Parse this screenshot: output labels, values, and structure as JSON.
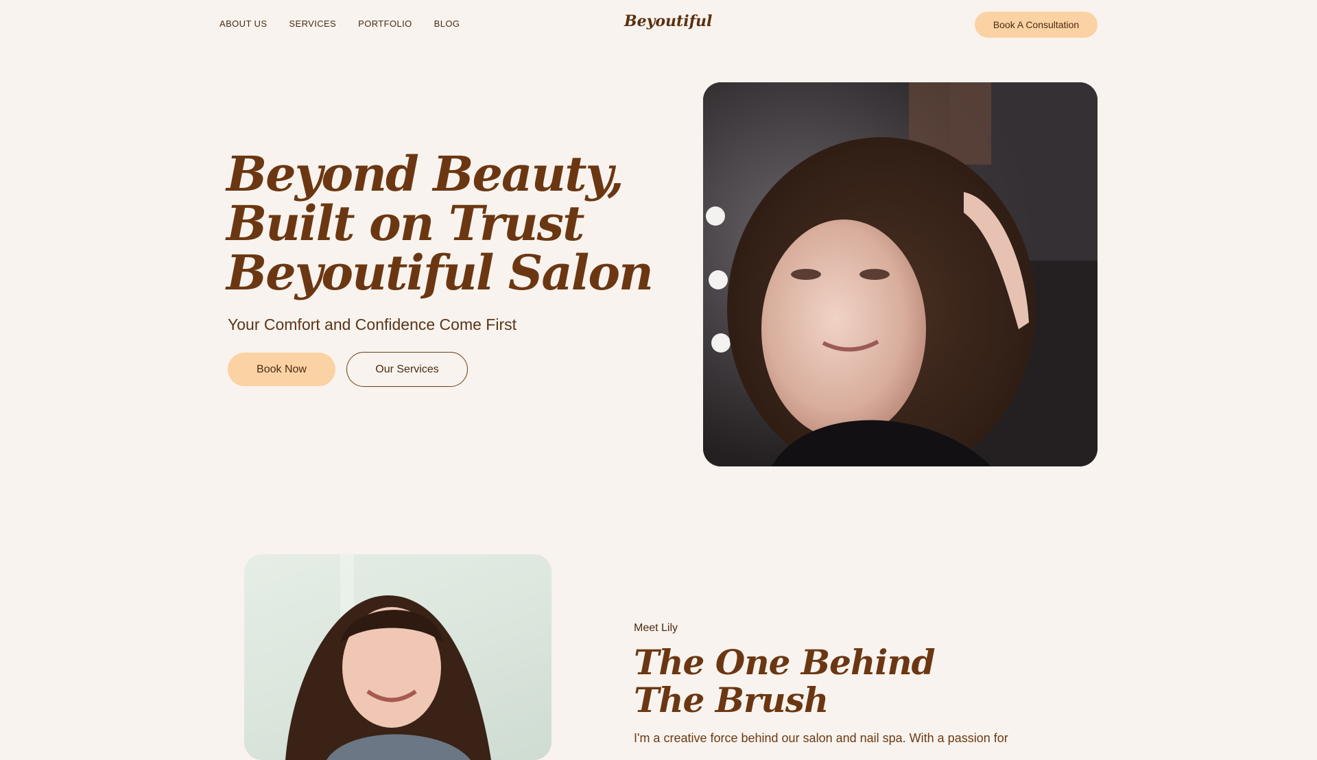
{
  "nav": {
    "links": [
      "ABOUT US",
      "SERVICES",
      "PORTFOLIO",
      "BLOG"
    ],
    "brand": "Beyoutiful",
    "cta_label": "Book A Consultation"
  },
  "hero": {
    "title_lines": [
      "Beyond Beauty,",
      "Built on Trust",
      "Beyoutiful Salon"
    ],
    "subtitle": "Your Comfort and Confidence Come First",
    "primary_button": "Book Now",
    "secondary_button": "Our Services"
  },
  "about": {
    "eyebrow": "Meet Lily",
    "title_lines": [
      "The One Behind",
      "The Brush"
    ],
    "body": "I'm a creative force behind our salon and nail spa. With a passion for"
  },
  "colors": {
    "background": "#f8f3ee",
    "accent": "#fbd2a3",
    "heading": "#6b3712",
    "text": "#4a2a12"
  }
}
